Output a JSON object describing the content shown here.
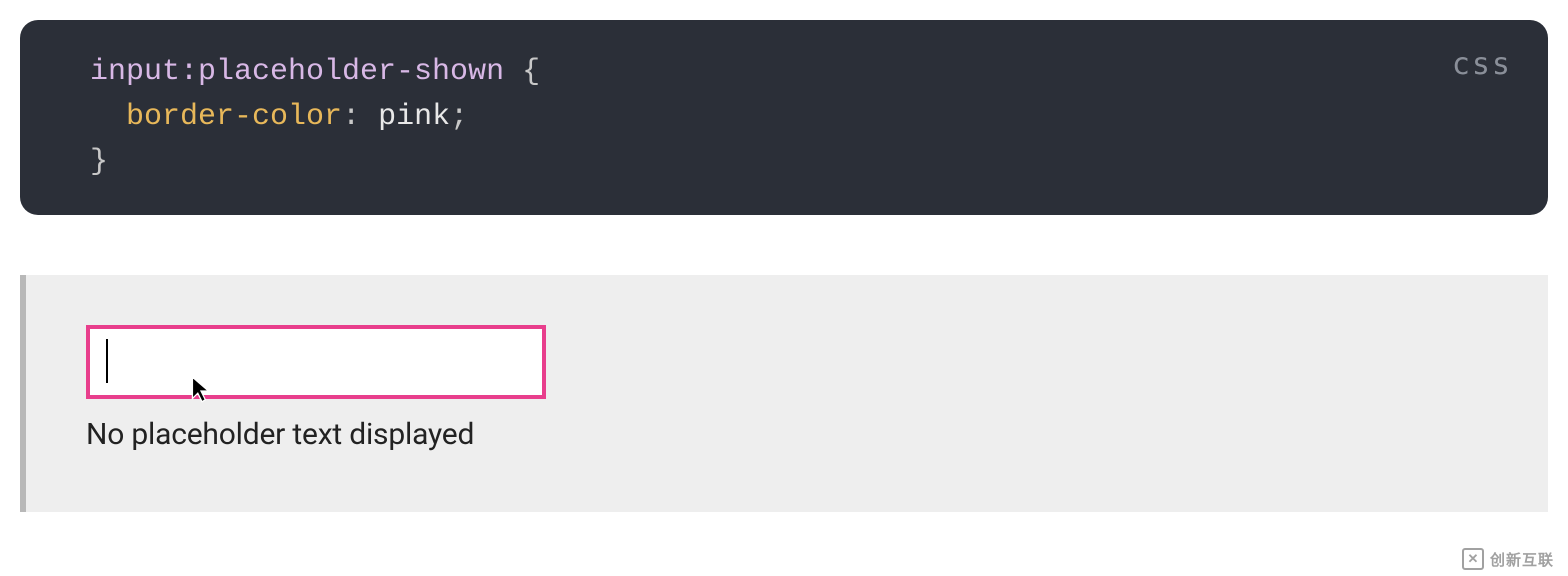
{
  "code": {
    "language": "css",
    "selector": "input",
    "pseudo": ":placeholder-shown",
    "open_brace": " {",
    "property": "border-color",
    "colon": ": ",
    "value": "pink",
    "semicolon": ";",
    "close_brace": "}"
  },
  "example": {
    "input_value": "",
    "caption": "No placeholder text displayed"
  },
  "watermark": {
    "icon_text": "✕",
    "text": "创新互联"
  }
}
